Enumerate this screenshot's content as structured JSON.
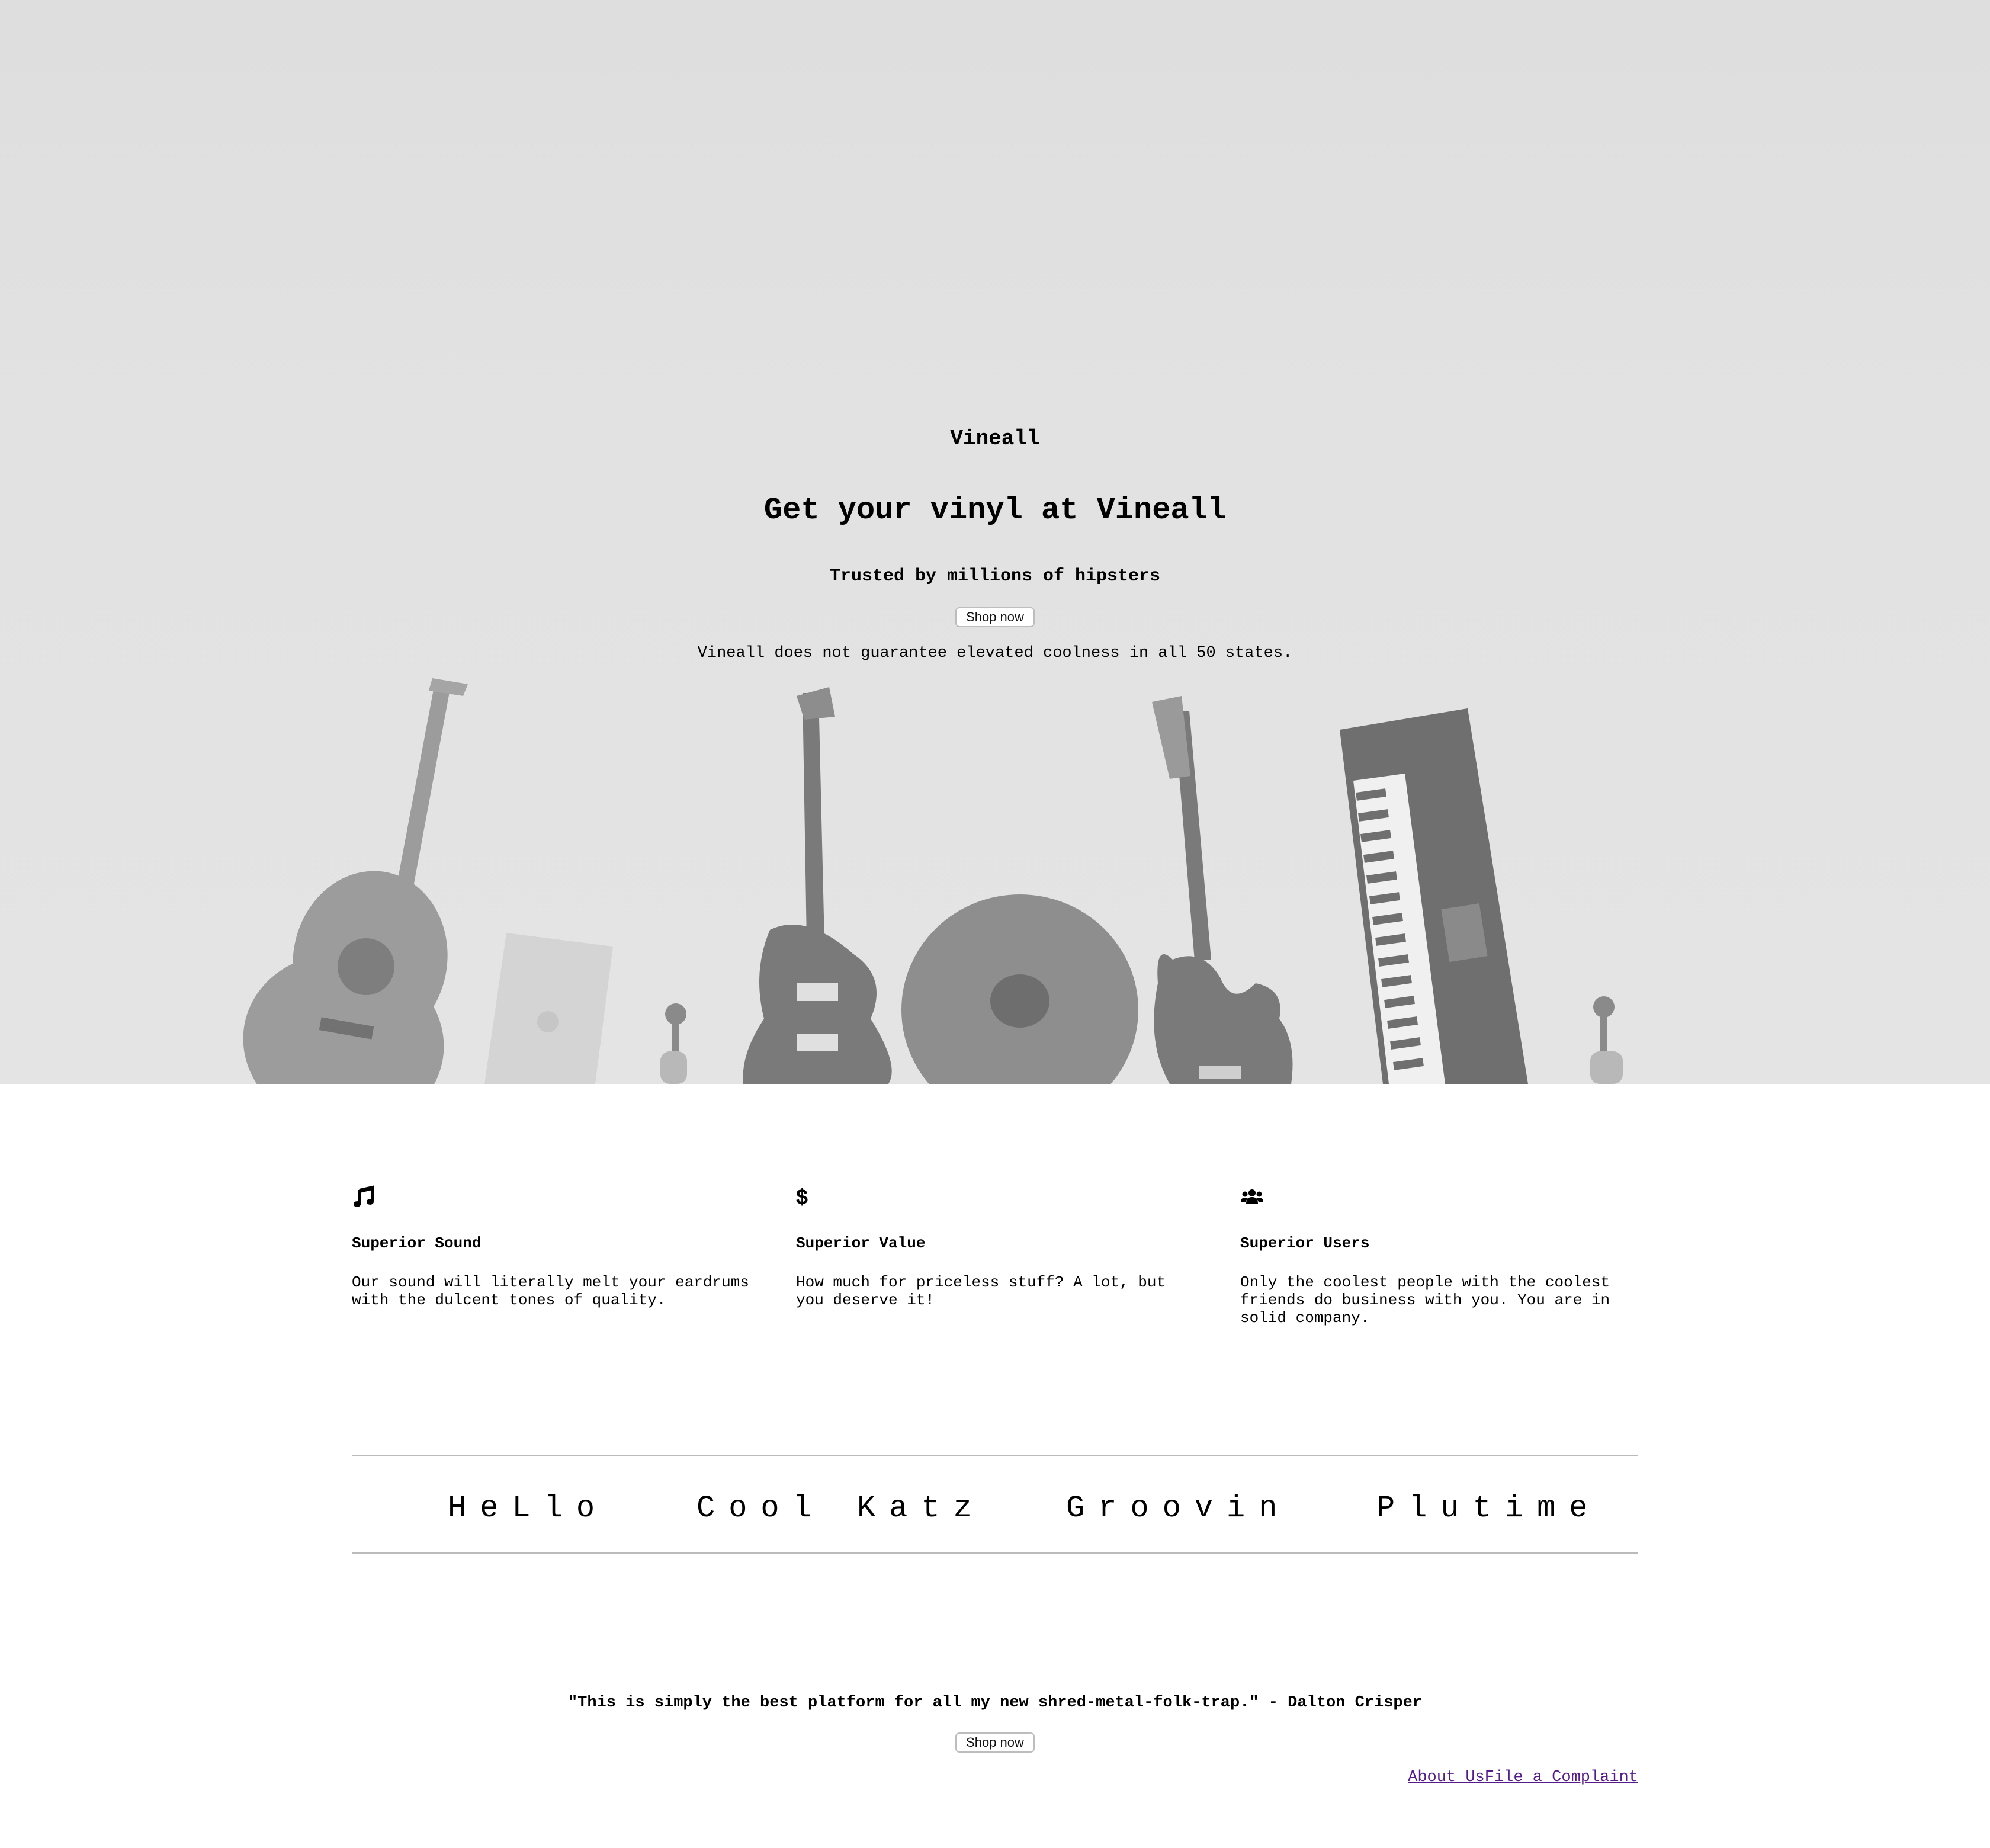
{
  "hero": {
    "brand": "Vineall",
    "headline": "Get your vinyl at Vineall",
    "subheadline": "Trusted by millions of hipsters",
    "button_label": "Shop now",
    "disclaimer": "Vineall does not guarantee elevated coolness in all 50 states."
  },
  "features": [
    {
      "icon": "music-note-icon",
      "title": "Superior Sound",
      "text": "Our sound will literally melt your eardrums with the dulcent tones of quality."
    },
    {
      "icon": "dollar-sign-icon",
      "title": "Superior Value",
      "text": "How much for priceless stuff? A lot, but you deserve it!"
    },
    {
      "icon": "users-icon",
      "title": "Superior Users",
      "text": "Only the coolest people with the coolest friends do business with you. You are in solid company."
    }
  ],
  "nav": {
    "items": [
      "HeLlo",
      "Cool Katz",
      "Groovin",
      "Plutime"
    ]
  },
  "testimonial": {
    "quote": "\"This is simply the best platform for all my new shred-metal-folk-trap.\" - Dalton Crisper",
    "button_label": "Shop now"
  },
  "footer": {
    "links": [
      "About Us",
      "File a Complaint"
    ]
  },
  "colors": {
    "hero_background": "#e2e2e2",
    "link_visited": "#551a8b",
    "divider": "#bbbbbb"
  }
}
